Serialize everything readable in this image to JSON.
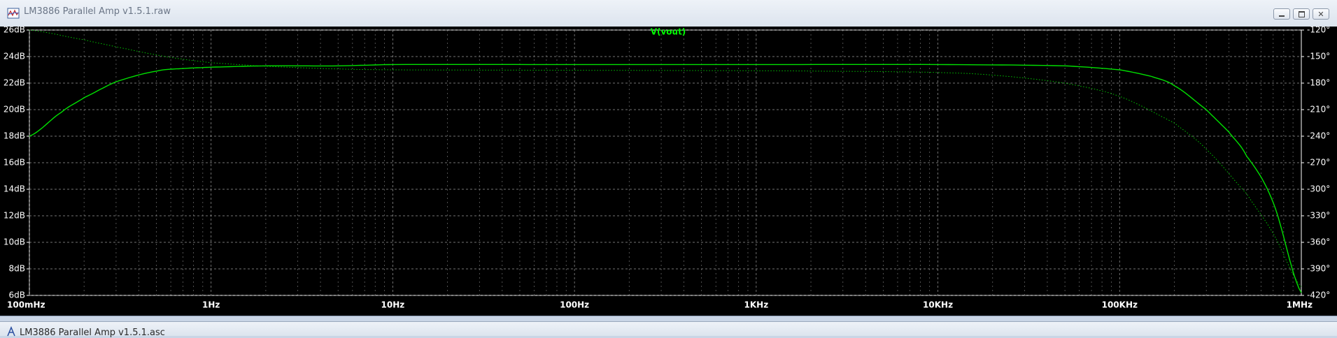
{
  "window": {
    "title": "LM3886 Parallel Amp v1.5.1.raw",
    "icon": "waveform-icon",
    "controls": [
      "minimize-icon",
      "restore-icon",
      "close-icon"
    ]
  },
  "window2": {
    "title": "LM3886 Parallel Amp v1.5.1.asc",
    "icon": "schematic-icon"
  },
  "chart_data": {
    "type": "line",
    "title": "V(vout)",
    "x_scale": "log",
    "x_ticks": [
      {
        "value": 0.1,
        "label": "100mHz"
      },
      {
        "value": 1,
        "label": "1Hz"
      },
      {
        "value": 10,
        "label": "10Hz"
      },
      {
        "value": 100,
        "label": "100Hz"
      },
      {
        "value": 1000,
        "label": "1KHz"
      },
      {
        "value": 10000,
        "label": "10KHz"
      },
      {
        "value": 100000,
        "label": "100KHz"
      },
      {
        "value": 1000000,
        "label": "1MHz"
      }
    ],
    "xlim": [
      0.1,
      1000000
    ],
    "y_left": {
      "ylim": [
        6,
        26
      ],
      "ticks": [
        "26dB",
        "24dB",
        "22dB",
        "20dB",
        "18dB",
        "16dB",
        "14dB",
        "12dB",
        "10dB",
        "8dB",
        "6dB"
      ],
      "values": [
        26,
        24,
        22,
        20,
        18,
        16,
        14,
        12,
        10,
        8,
        6
      ]
    },
    "y_right": {
      "ylim": [
        -420,
        -120
      ],
      "ticks": [
        "-120°",
        "-150°",
        "-180°",
        "-210°",
        "-240°",
        "-270°",
        "-300°",
        "-330°",
        "-360°",
        "-390°",
        "-420°"
      ],
      "values": [
        -120,
        -150,
        -180,
        -210,
        -240,
        -270,
        -300,
        -330,
        -360,
        -390,
        -420
      ]
    },
    "grid": true,
    "series": [
      {
        "style": "solid",
        "axis": "left",
        "color": "#00e000",
        "x": [
          0.1,
          0.15,
          0.2,
          0.3,
          0.5,
          0.7,
          1,
          2,
          5,
          10,
          100,
          1000,
          10000,
          50000,
          100000,
          150000,
          200000,
          300000,
          400000,
          500000,
          700000,
          1000000
        ],
        "y": [
          18,
          19.8,
          20.9,
          22.1,
          22.9,
          23.1,
          23.2,
          23.3,
          23.3,
          23.4,
          23.4,
          23.4,
          23.4,
          23.3,
          23.0,
          22.5,
          21.8,
          20.0,
          18.3,
          16.5,
          13.0,
          6.2
        ]
      },
      {
        "style": "dotted",
        "axis": "right",
        "color": "#00c000",
        "x": [
          0.1,
          0.2,
          0.3,
          0.5,
          0.7,
          1,
          2,
          5,
          10,
          100,
          1000,
          5000,
          10000,
          20000,
          50000,
          100000,
          200000,
          300000,
          500000,
          700000,
          1000000
        ],
        "y": [
          -120,
          -131,
          -139,
          -148,
          -153,
          -157,
          -161,
          -164,
          -165,
          -165.5,
          -166,
          -167,
          -168,
          -171,
          -180,
          -195,
          -225,
          -255,
          -305,
          -350,
          -410
        ]
      }
    ]
  }
}
